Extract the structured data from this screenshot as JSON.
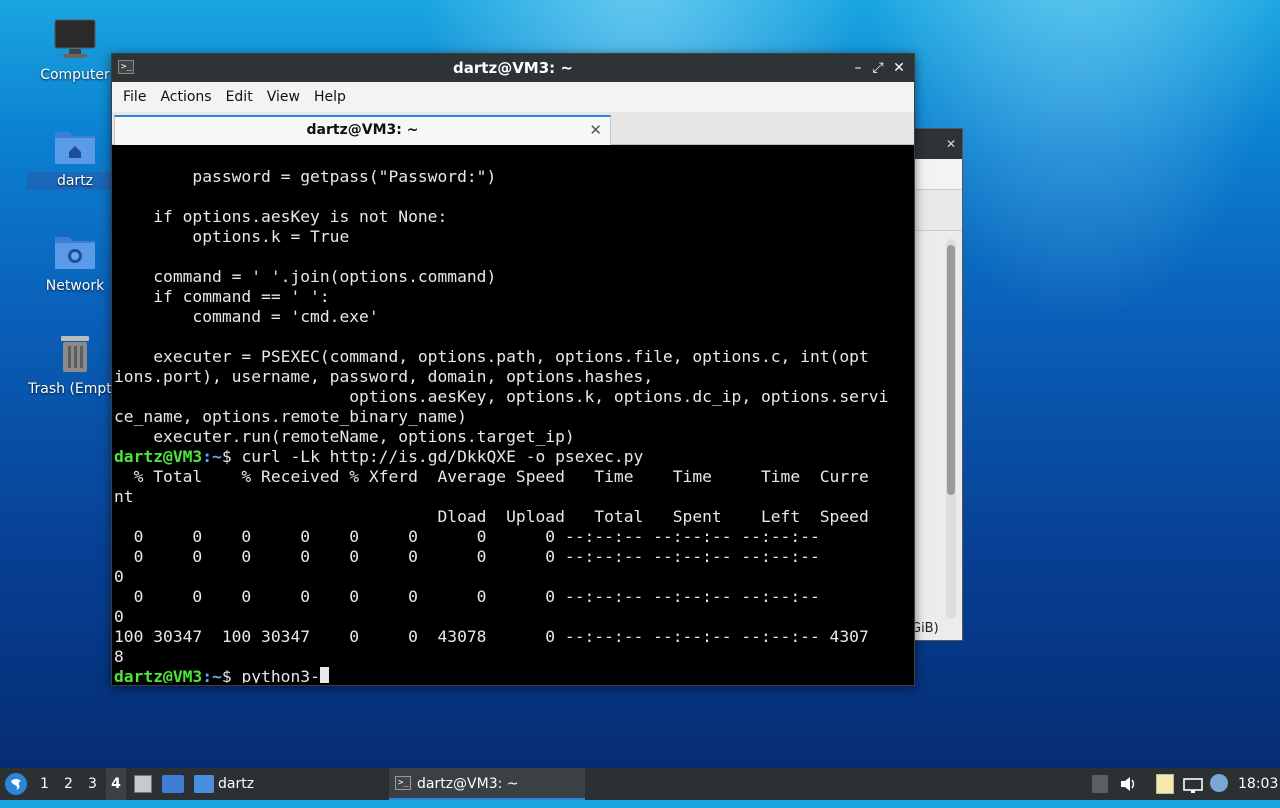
{
  "desktop": {
    "icons": [
      {
        "label": "Computer"
      },
      {
        "label": "dartz"
      },
      {
        "label": "Network"
      },
      {
        "label": "Trash (Empt"
      }
    ]
  },
  "background_window": {
    "footer_text": "GiB)",
    "close_glyph": "✕"
  },
  "terminal": {
    "window_title": "dartz@VM3: ~",
    "controls": {
      "minimize": "–",
      "maximize": "⤢",
      "close": "✕"
    },
    "menu": [
      "File",
      "Actions",
      "Edit",
      "View",
      "Help"
    ],
    "tab_title": "dartz@VM3: ~",
    "tab_close": "✕",
    "lines": [
      "        password = getpass(\"Password:\")",
      "",
      "    if options.aesKey is not None:",
      "        options.k = True",
      "",
      "    command = ' '.join(options.command)",
      "    if command == ' ':",
      "        command = 'cmd.exe'",
      "",
      "    executer = PSEXEC(command, options.path, options.file, options.c, int(opt",
      "ions.port), username, password, domain, options.hashes,",
      "                        options.aesKey, options.k, options.dc_ip, options.servi",
      "ce_name, options.remote_binary_name)",
      "    executer.run(remoteName, options.target_ip)"
    ],
    "prompt_user": "dartz@VM3",
    "prompt_path": ":~",
    "prompt_symbol": "$ ",
    "command1": "curl -Lk http://is.gd/DkkQXE -o psexec.py",
    "output": [
      "  % Total    % Received % Xferd  Average Speed   Time    Time     Time  Curre",
      "nt",
      "                                 Dload  Upload   Total   Spent    Left  Speed",
      "  0     0    0     0    0     0      0      0 --:--:-- --:--:-- --:--:--",
      "  0     0    0     0    0     0      0      0 --:--:-- --:--:-- --:--:--",
      "0",
      "  0     0    0     0    0     0      0      0 --:--:-- --:--:-- --:--:--",
      "0",
      "100 30347  100 30347    0     0  43078      0 --:--:-- --:--:-- --:--:-- 4307",
      "8"
    ],
    "command2": "python3-"
  },
  "taskbar": {
    "workspaces": [
      "1",
      "2",
      "3",
      "4"
    ],
    "active_workspace": "4",
    "folder_label": "dartz",
    "window_button_label": "dartz@VM3: ~",
    "clock": "18:03"
  }
}
